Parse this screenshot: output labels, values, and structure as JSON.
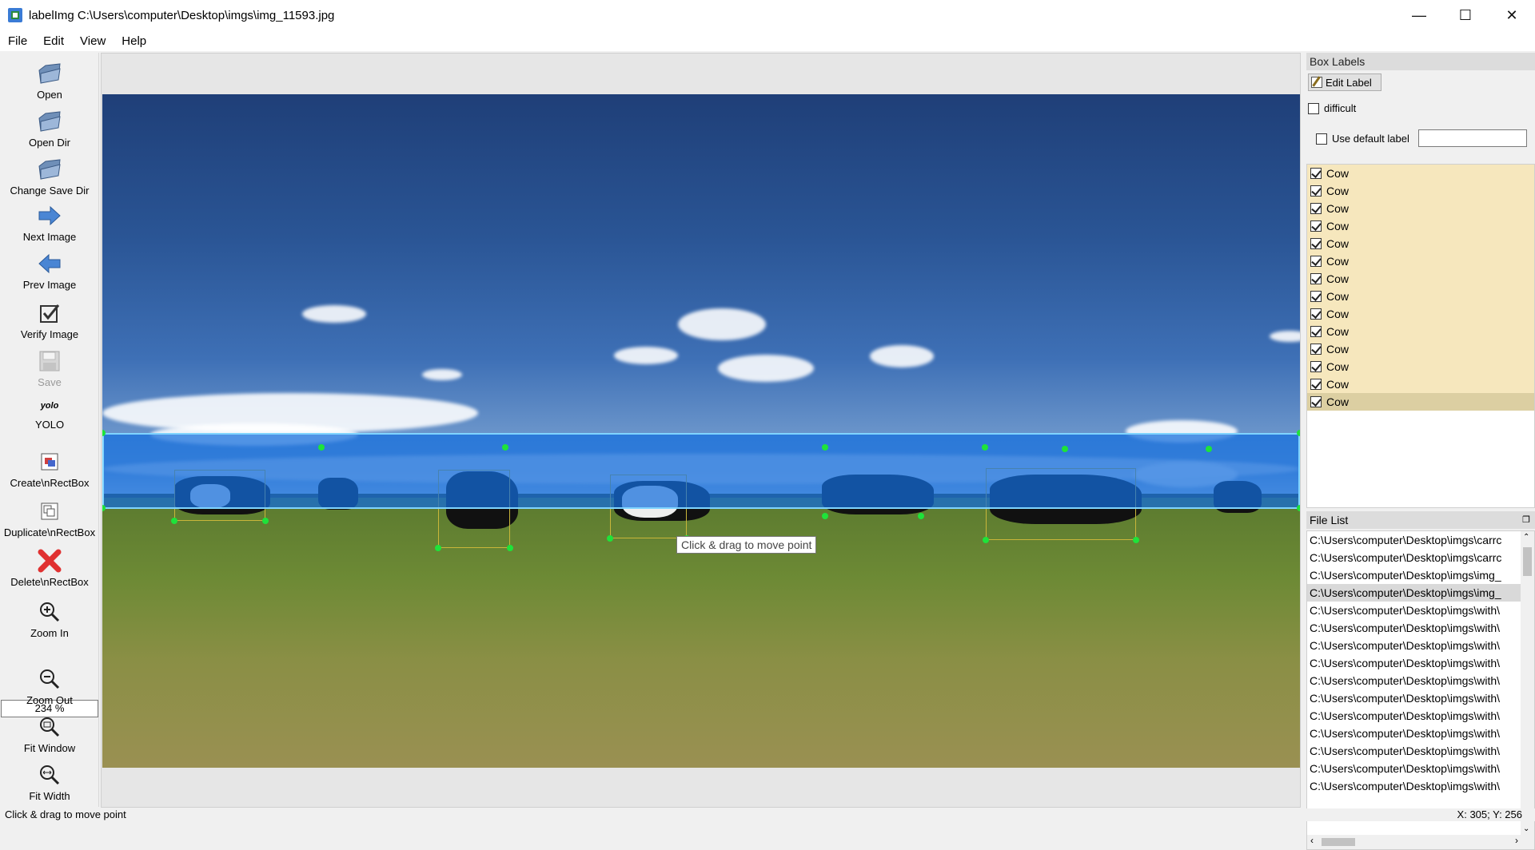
{
  "window": {
    "title": "labelImg C:\\Users\\computer\\Desktop\\imgs\\img_11593.jpg"
  },
  "menu": [
    "File",
    "Edit",
    "View",
    "Help"
  ],
  "tools": {
    "open": "Open",
    "open_dir": "Open Dir",
    "change_save_dir": "Change Save Dir",
    "next_image": "Next Image",
    "prev_image": "Prev Image",
    "verify_image": "Verify Image",
    "save": "Save",
    "yolo_icon": "yolo",
    "yolo": "YOLO",
    "create_rect": "Create\\nRectBox",
    "duplicate_rect": "Duplicate\\nRectBox",
    "delete_rect": "Delete\\nRectBox",
    "zoom_in": "Zoom In",
    "zoom_value": "234 %",
    "zoom_out": "Zoom Out",
    "fit_window": "Fit Window",
    "fit_width": "Fit Width"
  },
  "canvas": {
    "tooltip": "Click & drag to move point"
  },
  "box_labels": {
    "title": "Box Labels",
    "edit_label": "Edit Label",
    "difficult": "difficult",
    "use_default_label": "Use default label",
    "default_label_value": "",
    "labels": [
      "Cow",
      "Cow",
      "Cow",
      "Cow",
      "Cow",
      "Cow",
      "Cow",
      "Cow",
      "Cow",
      "Cow",
      "Cow",
      "Cow",
      "Cow",
      "Cow"
    ]
  },
  "file_list": {
    "title": "File List",
    "files": [
      "C:\\Users\\computer\\Desktop\\imgs\\carrc",
      "C:\\Users\\computer\\Desktop\\imgs\\carrc",
      "C:\\Users\\computer\\Desktop\\imgs\\img_",
      "C:\\Users\\computer\\Desktop\\imgs\\img_",
      "C:\\Users\\computer\\Desktop\\imgs\\with\\",
      "C:\\Users\\computer\\Desktop\\imgs\\with\\",
      "C:\\Users\\computer\\Desktop\\imgs\\with\\",
      "C:\\Users\\computer\\Desktop\\imgs\\with\\",
      "C:\\Users\\computer\\Desktop\\imgs\\with\\",
      "C:\\Users\\computer\\Desktop\\imgs\\with\\",
      "C:\\Users\\computer\\Desktop\\imgs\\with\\",
      "C:\\Users\\computer\\Desktop\\imgs\\with\\",
      "C:\\Users\\computer\\Desktop\\imgs\\with\\",
      "C:\\Users\\computer\\Desktop\\imgs\\with\\",
      "C:\\Users\\computer\\Desktop\\imgs\\with\\"
    ]
  },
  "status": {
    "left": "Click & drag to move point",
    "right": "X: 305; Y: 256"
  }
}
